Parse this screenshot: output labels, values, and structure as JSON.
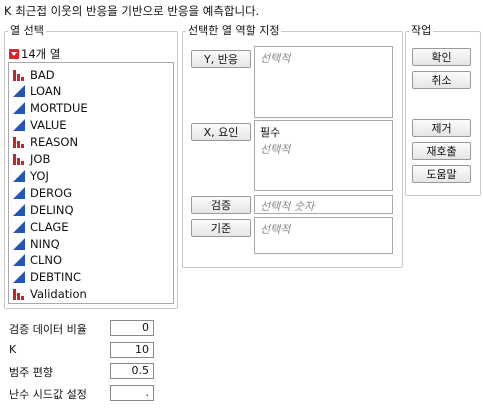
{
  "header": {
    "description": "K 최근접 이웃의 반응을 기반으로 반응을 예측합니다."
  },
  "column_select": {
    "legend": "열 선택",
    "count_label": "14개 열",
    "columns": [
      {
        "name": "BAD",
        "icon": "nominal-bar-icon"
      },
      {
        "name": "LOAN",
        "icon": "continuous-triangle-icon"
      },
      {
        "name": "MORTDUE",
        "icon": "continuous-triangle-icon"
      },
      {
        "name": "VALUE",
        "icon": "continuous-triangle-icon"
      },
      {
        "name": "REASON",
        "icon": "nominal-bar-icon"
      },
      {
        "name": "JOB",
        "icon": "nominal-bar-icon"
      },
      {
        "name": "YOJ",
        "icon": "continuous-triangle-icon"
      },
      {
        "name": "DEROG",
        "icon": "continuous-triangle-icon"
      },
      {
        "name": "DELINQ",
        "icon": "continuous-triangle-icon"
      },
      {
        "name": "CLAGE",
        "icon": "continuous-triangle-icon"
      },
      {
        "name": "NINQ",
        "icon": "continuous-triangle-icon"
      },
      {
        "name": "CLNO",
        "icon": "continuous-triangle-icon"
      },
      {
        "name": "DEBTINC",
        "icon": "continuous-triangle-icon"
      },
      {
        "name": "Validation",
        "icon": "nominal-bar-icon"
      }
    ]
  },
  "roles": {
    "legend": "선택한 열 역할 지정",
    "y_button": "Y, 반응",
    "y_placeholder": "선택적",
    "x_button": "X, 요인",
    "x_required": "필수",
    "x_placeholder": "선택적",
    "validation_button": "검증",
    "validation_placeholder": "선택적 숫자",
    "by_button": "기준",
    "by_placeholder": "선택적"
  },
  "actions": {
    "legend": "작업",
    "ok": "확인",
    "cancel": "취소",
    "remove": "제거",
    "recall": "재호출",
    "help": "도움말"
  },
  "options": {
    "validation_portion_label": "검증 데이터 비율",
    "validation_portion_value": "0",
    "k_label": "K",
    "k_value": "10",
    "bias_label": "범주 편향",
    "bias_value": "0.5",
    "seed_label": "난수 시드값 설정",
    "seed_value": "."
  },
  "colors": {
    "nominal": "#c0282d",
    "continuous": "#2456b8",
    "disclosure": "#d9262c"
  }
}
